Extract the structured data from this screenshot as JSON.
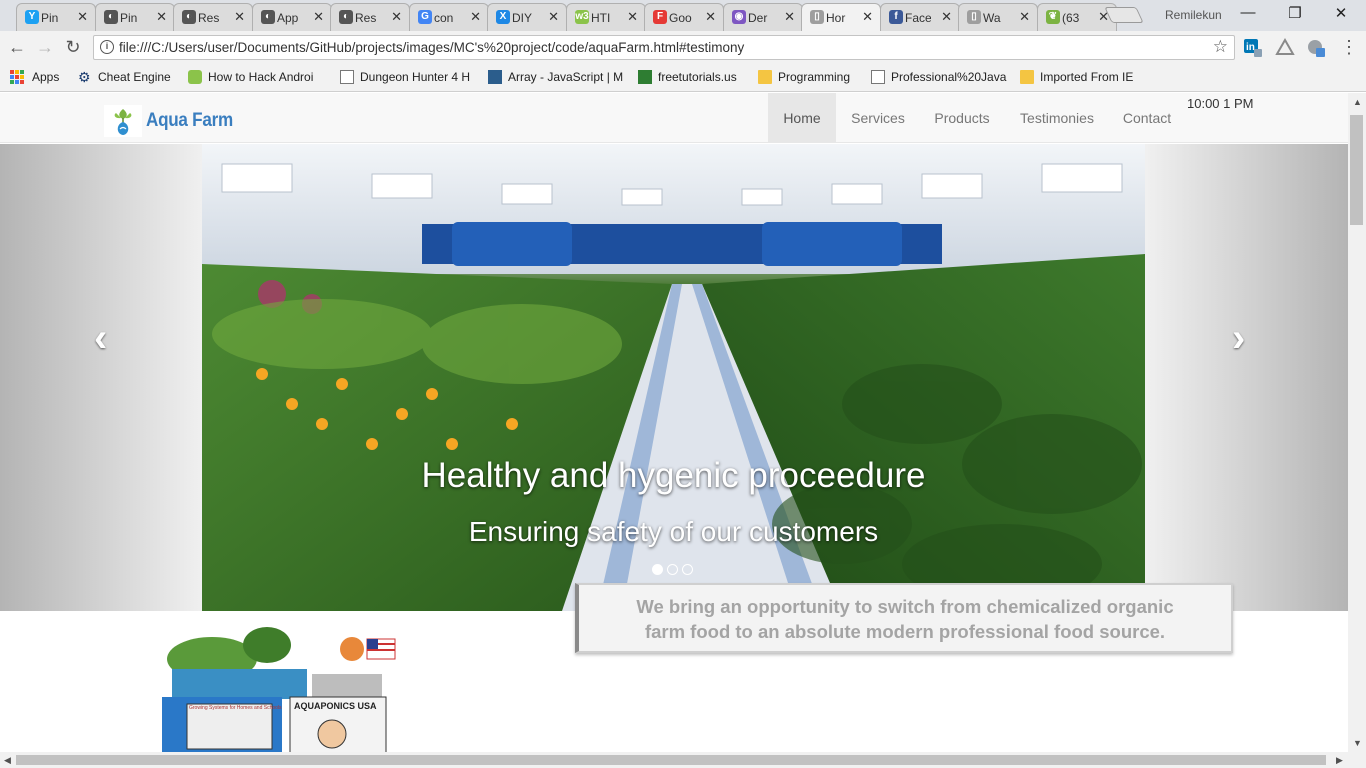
{
  "browser": {
    "tabs": [
      {
        "label": "Pin",
        "favicon_color": "#1da1f2",
        "favicon_char": "Y"
      },
      {
        "label": "Pin",
        "favicon_color": "#555555",
        "favicon_char": "◐"
      },
      {
        "label": "Res",
        "favicon_color": "#555555",
        "favicon_char": "◐"
      },
      {
        "label": "App",
        "favicon_color": "#555555",
        "favicon_char": "◐"
      },
      {
        "label": "Res",
        "favicon_color": "#555555",
        "favicon_char": "◐"
      },
      {
        "label": "con",
        "favicon_color": "#4285f4",
        "favicon_char": "G"
      },
      {
        "label": "DIY",
        "favicon_color": "#1e88e5",
        "favicon_char": "X"
      },
      {
        "label": "HTI",
        "favicon_color": "#8bc34a",
        "favicon_char": "w3"
      },
      {
        "label": "Goo",
        "favicon_color": "#e53935",
        "favicon_char": "F"
      },
      {
        "label": "Der",
        "favicon_color": "#7e57c2",
        "favicon_char": "◉"
      },
      {
        "label": "Hor",
        "favicon_color": "#9e9e9e",
        "favicon_char": "▯",
        "active": true
      },
      {
        "label": "Face",
        "favicon_color": "#3b5998",
        "favicon_char": "f"
      },
      {
        "label": "Wa",
        "favicon_color": "#9e9e9e",
        "favicon_char": "▯"
      },
      {
        "label": "(63",
        "favicon_color": "#7cb342",
        "favicon_char": "❦"
      }
    ],
    "profile_name": "Remilekun",
    "url": "file:///C:/Users/user/Documents/GitHub/projects/images/MC's%20project/code/aquaFarm.html#testimony",
    "bookmarks": [
      {
        "label": "Apps"
      },
      {
        "label": "Cheat Engine"
      },
      {
        "label": "How to Hack Androi"
      },
      {
        "label": "Dungeon Hunter 4 H"
      },
      {
        "label": "Array - JavaScript | M"
      },
      {
        "label": "freetutorials.us"
      },
      {
        "label": "Programming"
      },
      {
        "label": "Professional%20Java"
      },
      {
        "label": "Imported From IE"
      }
    ]
  },
  "site": {
    "brand": "Aqua Farm",
    "nav": [
      "Home",
      "Services",
      "Products",
      "Testimonies",
      "Contact"
    ],
    "active_nav": "Home",
    "clock": "10:00 1 PM",
    "carousel": {
      "title": "Healthy and hygenic proceedure",
      "subtitle": "Ensuring safety of our customers",
      "slide_count": 3,
      "active_index": 0
    },
    "promo_text_line1": "We bring an opportunity to switch from chemicalized organic",
    "promo_text_line2": "farm food to an absolute modern professional food source.",
    "aquaponics_sign": "AQUAPONICS USA",
    "aquaponics_banner": "Growing Systems for Homes and Schools"
  }
}
